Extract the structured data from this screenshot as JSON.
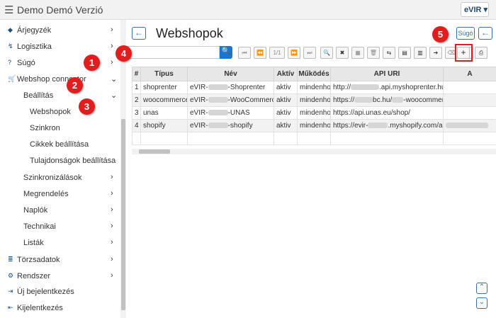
{
  "app": {
    "title": "Demo Demó Verzió",
    "logo": "eVIR"
  },
  "sidebar": {
    "items": [
      {
        "label": "Árjegyzék",
        "icon": "tags-icon",
        "indent": 0,
        "chevron": "›"
      },
      {
        "label": "Logisztika",
        "icon": "route-icon",
        "indent": 0,
        "chevron": "›"
      },
      {
        "label": "Súgó",
        "icon": "help-icon",
        "indent": 0,
        "chevron": "›"
      },
      {
        "label": "Webshop connector",
        "icon": "cart-icon",
        "indent": 0,
        "chevron": "⌄"
      },
      {
        "label": "Beállítás",
        "icon": "",
        "indent": 1,
        "chevron": "⌄"
      },
      {
        "label": "Webshopok",
        "icon": "",
        "indent": 2,
        "chevron": ""
      },
      {
        "label": "Szinkron",
        "icon": "",
        "indent": 2,
        "chevron": ""
      },
      {
        "label": "Cikkek beállítása",
        "icon": "",
        "indent": 2,
        "chevron": ""
      },
      {
        "label": "Tulajdonságok beállítása",
        "icon": "",
        "indent": 2,
        "chevron": ""
      },
      {
        "label": "Szinkronizálások",
        "icon": "",
        "indent": 1,
        "chevron": "›"
      },
      {
        "label": "Megrendelés",
        "icon": "",
        "indent": 1,
        "chevron": "›"
      },
      {
        "label": "Naplók",
        "icon": "",
        "indent": 1,
        "chevron": "›"
      },
      {
        "label": "Technikai",
        "icon": "",
        "indent": 1,
        "chevron": "›"
      },
      {
        "label": "Listák",
        "icon": "",
        "indent": 1,
        "chevron": "›"
      },
      {
        "label": "Törzsadatok",
        "icon": "database-icon",
        "indent": 0,
        "chevron": "›"
      },
      {
        "label": "Rendszer",
        "icon": "cogs-icon",
        "indent": 0,
        "chevron": "›"
      },
      {
        "label": "Új bejelentkezés",
        "icon": "sign-in-icon",
        "indent": 0,
        "chevron": ""
      },
      {
        "label": "Kijelentkezés",
        "icon": "sign-out-icon",
        "indent": 0,
        "chevron": ""
      }
    ]
  },
  "page": {
    "title": "Webshopok",
    "help_label": "Súgó",
    "back_symbol": "←"
  },
  "toolbar": {
    "page_indicator": "1/1",
    "search_value": ""
  },
  "table": {
    "columns": [
      "#",
      "Típus",
      "Név",
      "Aktív",
      "Működés",
      "API URI",
      "A"
    ],
    "rows": [
      {
        "n": "1",
        "type": "shoprenter",
        "name_pre": "eVIR-",
        "name_post": "-Shoprenter",
        "active": "aktiv",
        "mode": "mindenhol",
        "uri_pre": "http://",
        "uri_post": ".api.myshoprenter.hu"
      },
      {
        "n": "2",
        "type": "woocommerce",
        "name_pre": "eVIR-",
        "name_post": "-WooCommerce",
        "active": "aktiv",
        "mode": "mindenhol",
        "uri_pre": "https://",
        "uri_post": "bc.hu/",
        "uri_post2": "-woocommerce/"
      },
      {
        "n": "3",
        "type": "unas",
        "name_pre": "eVIR-",
        "name_post": "-UNAS",
        "active": "aktiv",
        "mode": "mindenhol",
        "uri_pre": "https://api.unas.eu/shop/",
        "uri_post": ""
      },
      {
        "n": "4",
        "type": "shopify",
        "name_pre": "eVIR-",
        "name_post": "-shopify",
        "active": "aktiv",
        "mode": "mindenhol",
        "uri_pre": "https://evir-",
        "uri_post": ".myshopify.com/admin"
      }
    ]
  },
  "callouts": [
    "1",
    "2",
    "3",
    "4",
    "5"
  ],
  "colors": {
    "accent": "#3a6ea5",
    "callout": "#e11d1d",
    "search_button": "#1976d2"
  }
}
